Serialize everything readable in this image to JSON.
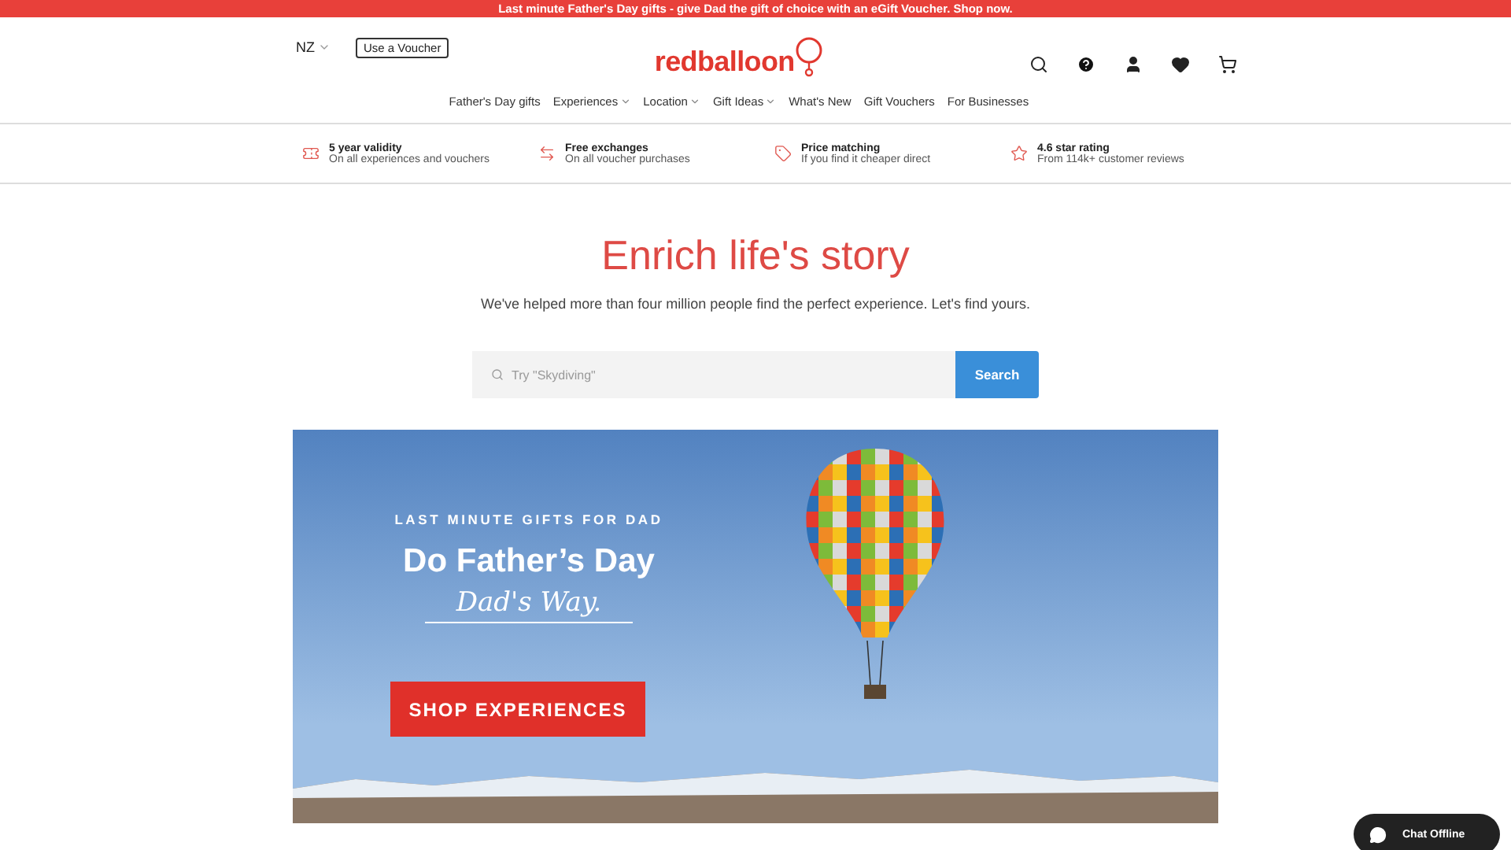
{
  "promo_bar": {
    "text": "Last minute Father's Day gifts - give Dad the gift of choice with an eGift Voucher. Shop now."
  },
  "header": {
    "country": "NZ",
    "voucher_button": "Use a Voucher",
    "logo": "redballoon"
  },
  "nav": [
    {
      "label": "Father's Day gifts",
      "dropdown": false
    },
    {
      "label": "Experiences",
      "dropdown": true
    },
    {
      "label": "Location",
      "dropdown": true
    },
    {
      "label": "Gift Ideas",
      "dropdown": true
    },
    {
      "label": "What's New",
      "dropdown": false
    },
    {
      "label": "Gift Vouchers",
      "dropdown": false
    },
    {
      "label": "For Businesses",
      "dropdown": false
    }
  ],
  "benefits": [
    {
      "kind": "ticket",
      "title": "5 year validity",
      "subtitle": "On all experiences and vouchers"
    },
    {
      "kind": "exchange",
      "title": "Free exchanges",
      "subtitle": "On all voucher purchases"
    },
    {
      "kind": "tag",
      "title": "Price matching",
      "subtitle": "If you find it cheaper direct"
    },
    {
      "kind": "star",
      "title": "4.6 star rating",
      "subtitle": "From 114k+ customer reviews"
    }
  ],
  "hero": {
    "title": "Enrich life's story",
    "subtitle": "We've helped more than four million people find the perfect experience. Let's find yours.",
    "search": {
      "placeholder": "Try \"Skydiving\"",
      "button": "Search"
    }
  },
  "banner": {
    "eyebrow": "LAST MINUTE GIFTS FOR DAD",
    "headline": "Do Father’s Day",
    "script": "Dad's Way.",
    "button": "SHOP EXPERIENCES"
  },
  "chat": {
    "label": "Chat Offline"
  }
}
